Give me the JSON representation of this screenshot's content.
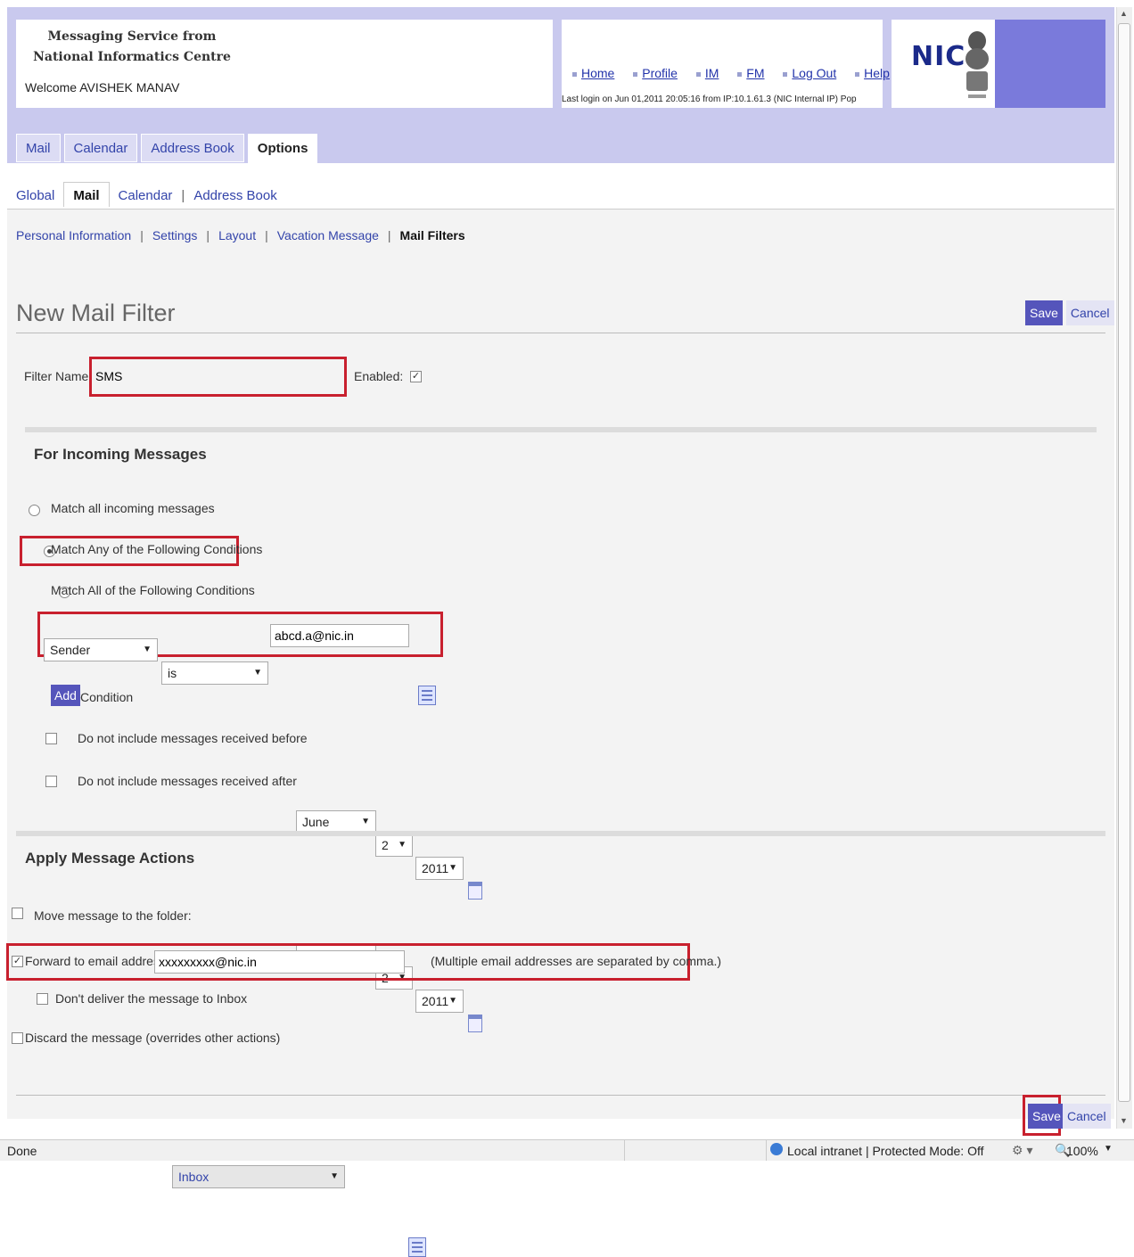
{
  "header": {
    "brand_line1": "Messaging Service from",
    "brand_line2": "National Informatics Centre",
    "welcome": "Welcome AVISHEK MANAV",
    "nav": [
      "Home",
      "Profile",
      "IM",
      "FM",
      "Log Out",
      "Help"
    ],
    "last_login": "Last login on Jun 01,2011 20:05:16 from IP:10.1.61.3 (NIC Internal IP) Pop",
    "logo_text": "NIC"
  },
  "main_tabs": [
    "Mail",
    "Calendar",
    "Address Book",
    "Options"
  ],
  "sub_tabs": [
    "Global",
    "Mail",
    "Calendar",
    "Address Book"
  ],
  "mail_links": [
    "Personal Information",
    "Settings",
    "Layout",
    "Vacation Message",
    "Mail Filters"
  ],
  "page_title": "New Mail Filter",
  "buttons": {
    "save": "Save",
    "cancel": "Cancel",
    "add": "Add"
  },
  "filter": {
    "name_label": "Filter Name:",
    "name_value": "SMS",
    "enabled_label": "Enabled:",
    "enabled_checked": true
  },
  "incoming": {
    "heading": "For Incoming Messages",
    "options": [
      "Match all incoming messages",
      "Match Any of the Following Conditions",
      "Match All of the Following Conditions"
    ],
    "selected_index": 1,
    "condition": {
      "field": "Sender",
      "operator": "is",
      "value": "abcd.a@nic.in"
    },
    "add_condition_label": "Condition",
    "before_label": "Do not include messages received before",
    "after_label": "Do not include messages received after",
    "date_month": "June",
    "date_day": "2",
    "date_year": "2011"
  },
  "actions": {
    "heading": "Apply Message Actions",
    "move_label": "Move message to the folder:",
    "move_folder": "Inbox",
    "forward_label": "Forward to email address:",
    "forward_value": "xxxxxxxxx@nic.in",
    "forward_note": "(Multiple email addresses are separated by comma.)",
    "forward_checked": true,
    "dont_deliver_label": "Don't deliver the message to Inbox",
    "discard_label": "Discard the message (overrides other actions)"
  },
  "status_bar": {
    "left": "Done",
    "zone": "Local intranet | Protected Mode: Off",
    "zoom": "100%"
  },
  "colors": {
    "accent": "#5555bb",
    "header_bg": "#c9c9ee",
    "highlight": "#c8202e",
    "link": "#3344aa"
  }
}
